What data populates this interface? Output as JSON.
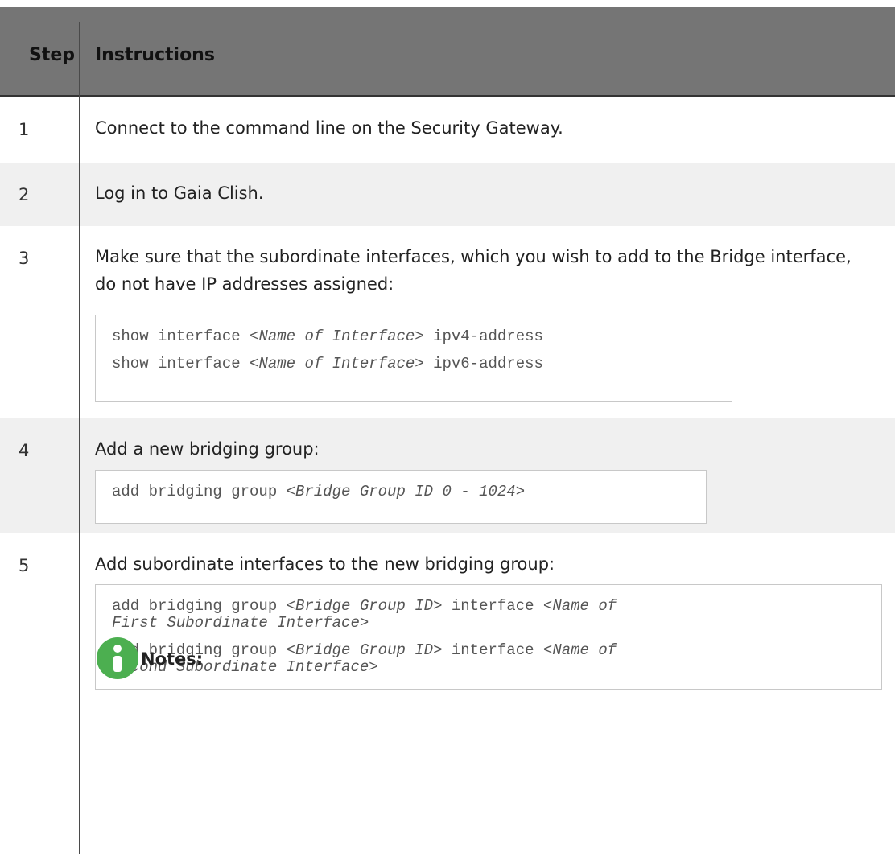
{
  "header": {
    "step": "Step",
    "instructions": "Instructions"
  },
  "rows": [
    {
      "step": "1",
      "text": "Connect to the command line on the Security Gateway."
    },
    {
      "step": "2",
      "text": "Log in to Gaia Clish."
    },
    {
      "step": "3",
      "text": "Make sure that the subordinate interfaces, which you wish to add to the Bridge interface, do not have IP addresses assigned:",
      "code": [
        {
          "pre": "show interface <",
          "it": "Name of Interface",
          "post": "> ipv4-address"
        },
        {
          "pre": "show interface <",
          "it": "Name of Interface",
          "post": "> ipv6-address"
        }
      ]
    },
    {
      "step": "4",
      "text": "Add a new bridging group:",
      "code": [
        {
          "pre": "add bridging group <",
          "it": "Bridge Group ID 0 - 1024",
          "post": ">"
        }
      ]
    },
    {
      "step": "5",
      "text": "Add subordinate interfaces to the new bridging group:",
      "code": [
        {
          "pre": "add bridging group <",
          "it": "Bridge Group ID",
          "mid": "> interface <",
          "it2": "Name of",
          "post": ""
        },
        {
          "pre": "",
          "it": "First Subordinate Interface",
          "post": ">"
        },
        {
          "pre": "add bridging group <",
          "it": "Bridge Group ID",
          "mid": "> interface <",
          "it2": "Name of",
          "post": ""
        },
        {
          "pre": "",
          "it": "Second Subordinate Interface",
          "post": ">"
        }
      ],
      "note_title": "Notes:"
    }
  ]
}
